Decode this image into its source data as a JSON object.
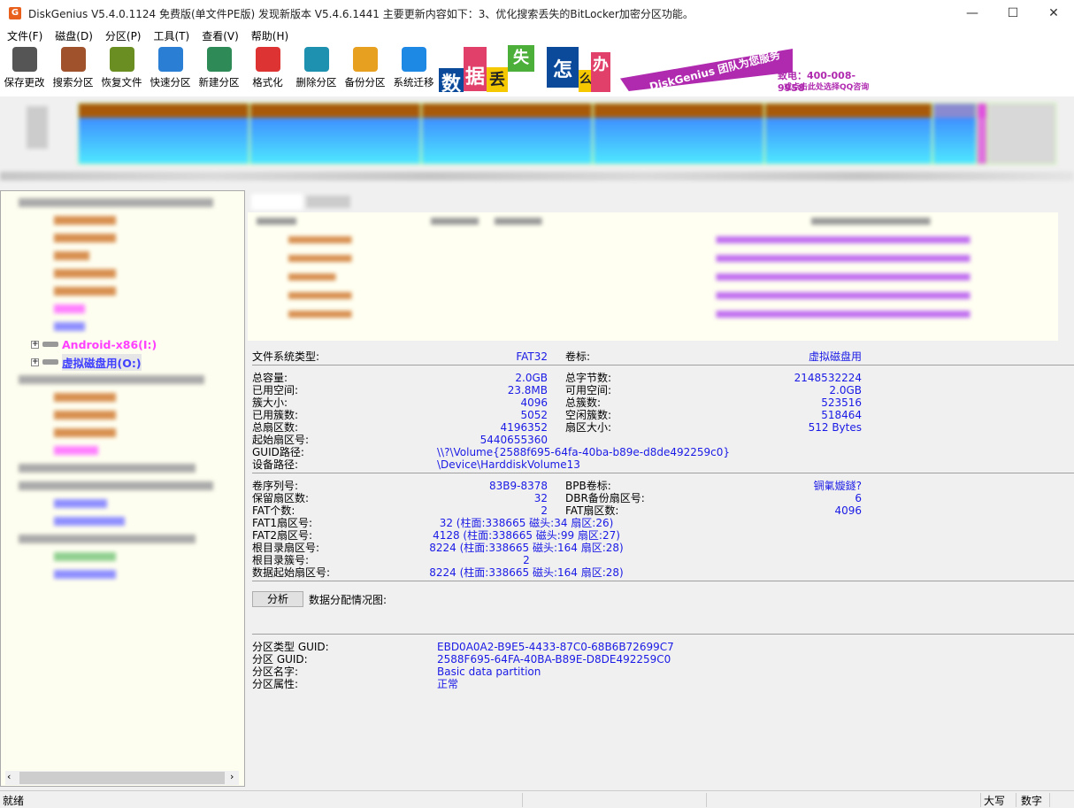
{
  "window": {
    "title": "DiskGenius V5.4.0.1124 免费版(单文件PE版)   发现新版本 V5.4.6.1441 主要更新内容如下：3、优化搜索丢失的BitLocker加密分区功能。",
    "minimize": "—",
    "maximize": "☐",
    "close": "✕",
    "icon": "G"
  },
  "menu": [
    "文件(F)",
    "磁盘(D)",
    "分区(P)",
    "工具(T)",
    "查看(V)",
    "帮助(H)"
  ],
  "toolbar": [
    {
      "label": "保存更改",
      "icon": "save-icon",
      "color": "#555"
    },
    {
      "label": "搜索分区",
      "icon": "magnifier-icon",
      "color": "#a0522d"
    },
    {
      "label": "恢复文件",
      "icon": "recover-icon",
      "color": "#6b8e23"
    },
    {
      "label": "快速分区",
      "icon": "quick-partition-icon",
      "color": "#2a7fd4"
    },
    {
      "label": "新建分区",
      "icon": "new-partition-icon",
      "color": "#2e8b57"
    },
    {
      "label": "格式化",
      "icon": "format-icon",
      "color": "#d33"
    },
    {
      "label": "删除分区",
      "icon": "trash-icon",
      "color": "#1e90b0"
    },
    {
      "label": "备份分区",
      "icon": "backup-icon",
      "color": "#e8a020"
    },
    {
      "label": "系统迁移",
      "icon": "migrate-icon",
      "color": "#1e88e5"
    }
  ],
  "banner": {
    "chars": [
      "数",
      "据",
      "丢",
      "失",
      "怎",
      "么",
      "办",
      "!"
    ],
    "slogan": "DiskGenius 团队为您服务",
    "phone": "致电：400-008-9958",
    "qq": "或点击此处选择QQ咨询"
  },
  "tree": {
    "visible_items": [
      {
        "label": "Android-x86(I:)",
        "color": "#ff40ff"
      },
      {
        "label": "虚拟磁盘用(O:)",
        "color": "#4040ff",
        "selected": true
      }
    ]
  },
  "details": {
    "fs_type_label": "文件系统类型:",
    "fs_type": "FAT32",
    "volume_label_label": "卷标:",
    "volume_label": "虚拟磁盘用",
    "rows1": [
      [
        "总容量:",
        "2.0GB",
        "总字节数:",
        "2148532224"
      ],
      [
        "已用空间:",
        "23.8MB",
        "可用空间:",
        "2.0GB"
      ],
      [
        "簇大小:",
        "4096",
        "总簇数:",
        "523516"
      ],
      [
        "已用簇数:",
        "5052",
        "空闲簇数:",
        "518464"
      ],
      [
        "总扇区数:",
        "4196352",
        "扇区大小:",
        "512 Bytes"
      ],
      [
        "起始扇区号:",
        "5440655360",
        "",
        ""
      ]
    ],
    "guid_path_label": "GUID路径:",
    "guid_path": "\\\\?\\Volume{2588f695-64fa-40ba-b89e-d8de492259c0}",
    "device_path_label": "设备路径:",
    "device_path": "\\Device\\HarddiskVolume13",
    "rows2": [
      [
        "卷序列号:",
        "83B9-8378",
        "BPB卷标:",
        "锎氭嫙鐩?"
      ],
      [
        "保留扇区数:",
        "32",
        "DBR备份扇区号:",
        "6"
      ],
      [
        "FAT个数:",
        "2",
        "FAT扇区数:",
        "4096"
      ],
      [
        "FAT1扇区号:",
        "32 (柱面:338665 磁头:34 扇区:26)",
        "",
        ""
      ],
      [
        "FAT2扇区号:",
        "4128 (柱面:338665 磁头:99 扇区:27)",
        "",
        ""
      ],
      [
        "根目录扇区号:",
        "8224 (柱面:338665 磁头:164 扇区:28)",
        "",
        ""
      ],
      [
        "根目录簇号:",
        "2",
        "",
        ""
      ],
      [
        "数据起始扇区号:",
        "8224 (柱面:338665 磁头:164 扇区:28)",
        "",
        ""
      ]
    ],
    "analyze_button": "分析",
    "allocation_label": "数据分配情况图:",
    "rows3": [
      [
        "分区类型 GUID:",
        "EBD0A0A2-B9E5-4433-87C0-68B6B72699C7"
      ],
      [
        "分区 GUID:",
        "2588F695-64FA-40BA-B89E-D8DE492259C0"
      ],
      [
        "分区名字:",
        "Basic data partition"
      ],
      [
        "分区属性:",
        "正常"
      ]
    ]
  },
  "statusbar": {
    "status": "就绪",
    "caps": "大写",
    "num": "数字"
  }
}
